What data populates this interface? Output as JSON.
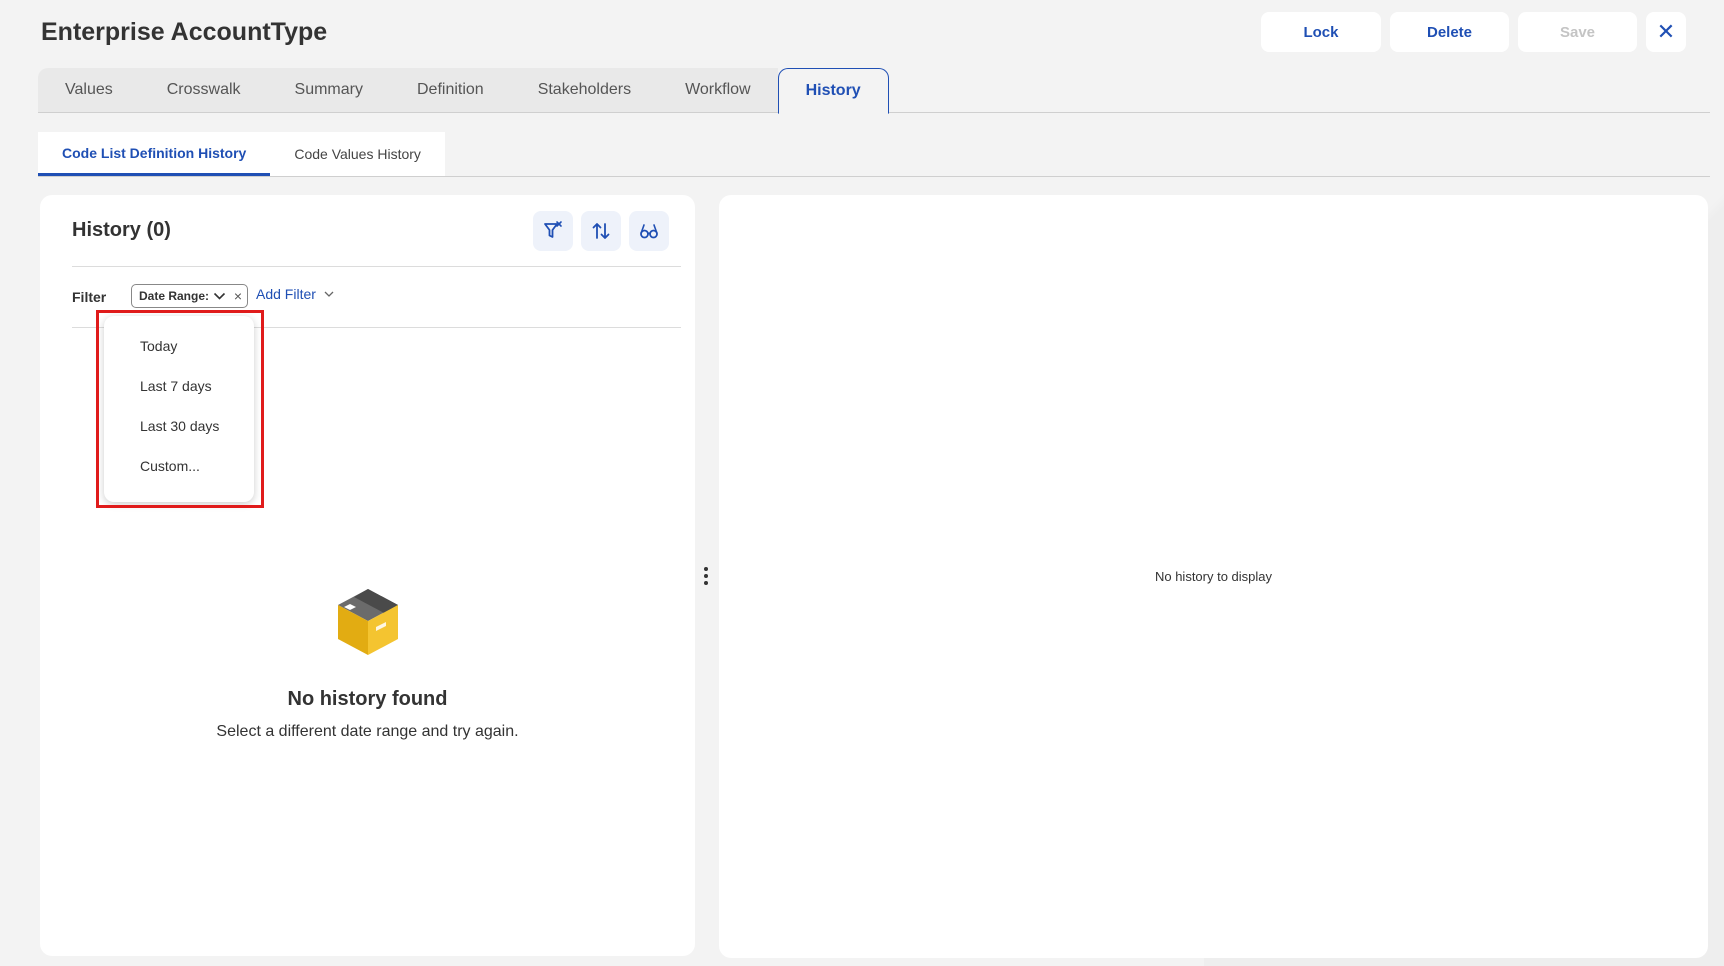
{
  "header": {
    "title": "Enterprise AccountType",
    "actions": {
      "lock": "Lock",
      "delete": "Delete",
      "save": "Save",
      "close": "✕"
    }
  },
  "tabs": [
    {
      "label": "Values"
    },
    {
      "label": "Crosswalk"
    },
    {
      "label": "Summary"
    },
    {
      "label": "Definition"
    },
    {
      "label": "Stakeholders"
    },
    {
      "label": "Workflow"
    },
    {
      "label": "History",
      "active": true
    }
  ],
  "subtabs": [
    {
      "label": "Code List Definition History",
      "active": true
    },
    {
      "label": "Code Values History"
    }
  ],
  "history_panel": {
    "title": "History (0)",
    "icons": [
      "clear-filter-icon",
      "sort-icon",
      "view-icon"
    ],
    "filter_label": "Filter",
    "chip_label": "Date Range:",
    "chip_remove": "×",
    "add_filter": "Add Filter",
    "dropdown_options": [
      "Today",
      "Last 7 days",
      "Last 30 days",
      "Custom..."
    ],
    "empty_title": "No history found",
    "empty_subtitle": "Select a different date range and try again."
  },
  "detail_panel": {
    "empty_text": "No history to display"
  },
  "colors": {
    "accent": "#1f4fb4",
    "highlight": "#e01b1b",
    "box_yellow": "#f4c430"
  }
}
